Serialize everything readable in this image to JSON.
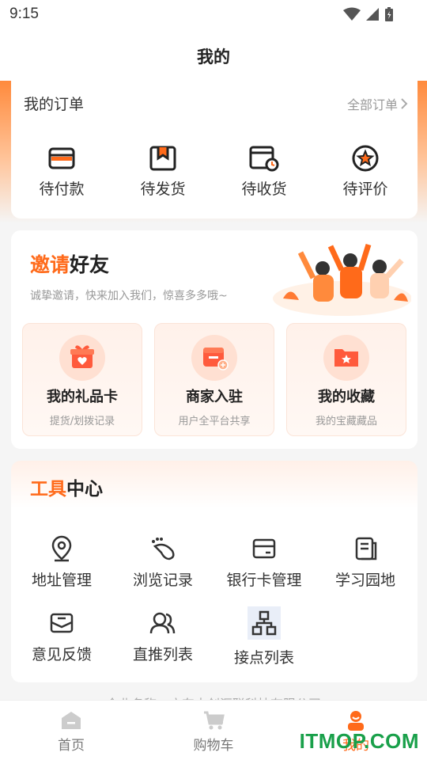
{
  "status": {
    "time": "9:15"
  },
  "header": {
    "title": "我的"
  },
  "orders": {
    "title": "我的订单",
    "all_link": "全部订单",
    "items": [
      {
        "label": "待付款",
        "icon": "wallet-card-icon"
      },
      {
        "label": "待发货",
        "icon": "package-box-icon"
      },
      {
        "label": "待收货",
        "icon": "delivery-box-clock-icon"
      },
      {
        "label": "待评价",
        "icon": "star-badge-icon"
      }
    ]
  },
  "invite": {
    "title_highlight": "邀请",
    "title_rest": "好友",
    "subtitle": "诚挚邀请，快来加入我们，惊喜多多哦~",
    "cards": [
      {
        "title": "我的礼品卡",
        "subtitle": "提货/划拨记录",
        "icon": "gift-icon"
      },
      {
        "title": "商家入驻",
        "subtitle": "用户全平台共享",
        "icon": "store-add-icon"
      },
      {
        "title": "我的收藏",
        "subtitle": "我的宝藏藏品",
        "icon": "star-folder-icon"
      }
    ]
  },
  "tools": {
    "title_highlight": "工具",
    "title_rest": "中心",
    "items": [
      {
        "label": "地址管理",
        "icon": "location-pin-icon"
      },
      {
        "label": "浏览记录",
        "icon": "footprint-icon"
      },
      {
        "label": "银行卡管理",
        "icon": "bank-card-icon"
      },
      {
        "label": "学习园地",
        "icon": "document-icon"
      },
      {
        "label": "意见反馈",
        "icon": "mail-feedback-icon"
      },
      {
        "label": "直推列表",
        "icon": "users-icon"
      },
      {
        "label": "接点列表",
        "icon": "hierarchy-icon"
      }
    ]
  },
  "company": {
    "text": "企业名称：广东中创汇联科技有限公司"
  },
  "tabbar": {
    "items": [
      {
        "label": "首页",
        "icon": "home-icon"
      },
      {
        "label": "购物车",
        "icon": "cart-icon"
      },
      {
        "label": "我的",
        "icon": "profile-icon"
      }
    ],
    "active_index": 2
  },
  "watermark": {
    "text": "ITMOP.COM"
  },
  "colors": {
    "accent": "#ff6a1a",
    "watermark": "#19a04a"
  }
}
